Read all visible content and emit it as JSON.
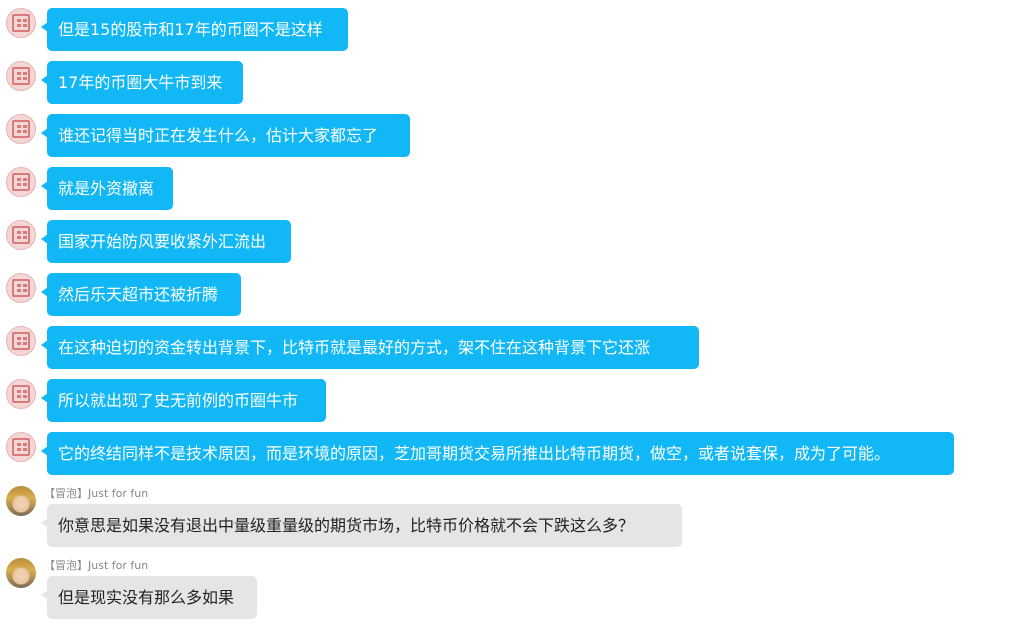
{
  "messages": [
    {
      "from": "self",
      "text": "但是15的股市和17年的币圈不是这样"
    },
    {
      "from": "self",
      "text": "17年的币圈大牛市到来"
    },
    {
      "from": "self",
      "text": "谁还记得当时正在发生什么，估计大家都忘了"
    },
    {
      "from": "self",
      "text": "就是外资撤离"
    },
    {
      "from": "self",
      "text": "国家开始防风要收紧外汇流出"
    },
    {
      "from": "self",
      "text": "然后乐天超市还被折腾"
    },
    {
      "from": "self",
      "text": "在这种迫切的资金转出背景下，比特币就是最好的方式，架不住在这种背景下它还涨"
    },
    {
      "from": "self",
      "text": "所以就出现了史无前例的币圈牛市"
    },
    {
      "from": "self",
      "text": "它的终结同样不是技术原因，而是环境的原因，芝加哥期货交易所推出比特币期货，做空，或者说套保，成为了可能。"
    },
    {
      "from": "other",
      "sender": "【冒泡】Just for fun",
      "text": "你意思是如果没有退出中量级重量级的期货市场，比特币价格就不会下跌这么多？"
    },
    {
      "from": "other",
      "sender": "【冒泡】Just for fun",
      "text": "但是现实没有那么多如果"
    }
  ],
  "colors": {
    "self_bubble": "#12b7f5",
    "other_bubble": "#e5e5e5"
  }
}
